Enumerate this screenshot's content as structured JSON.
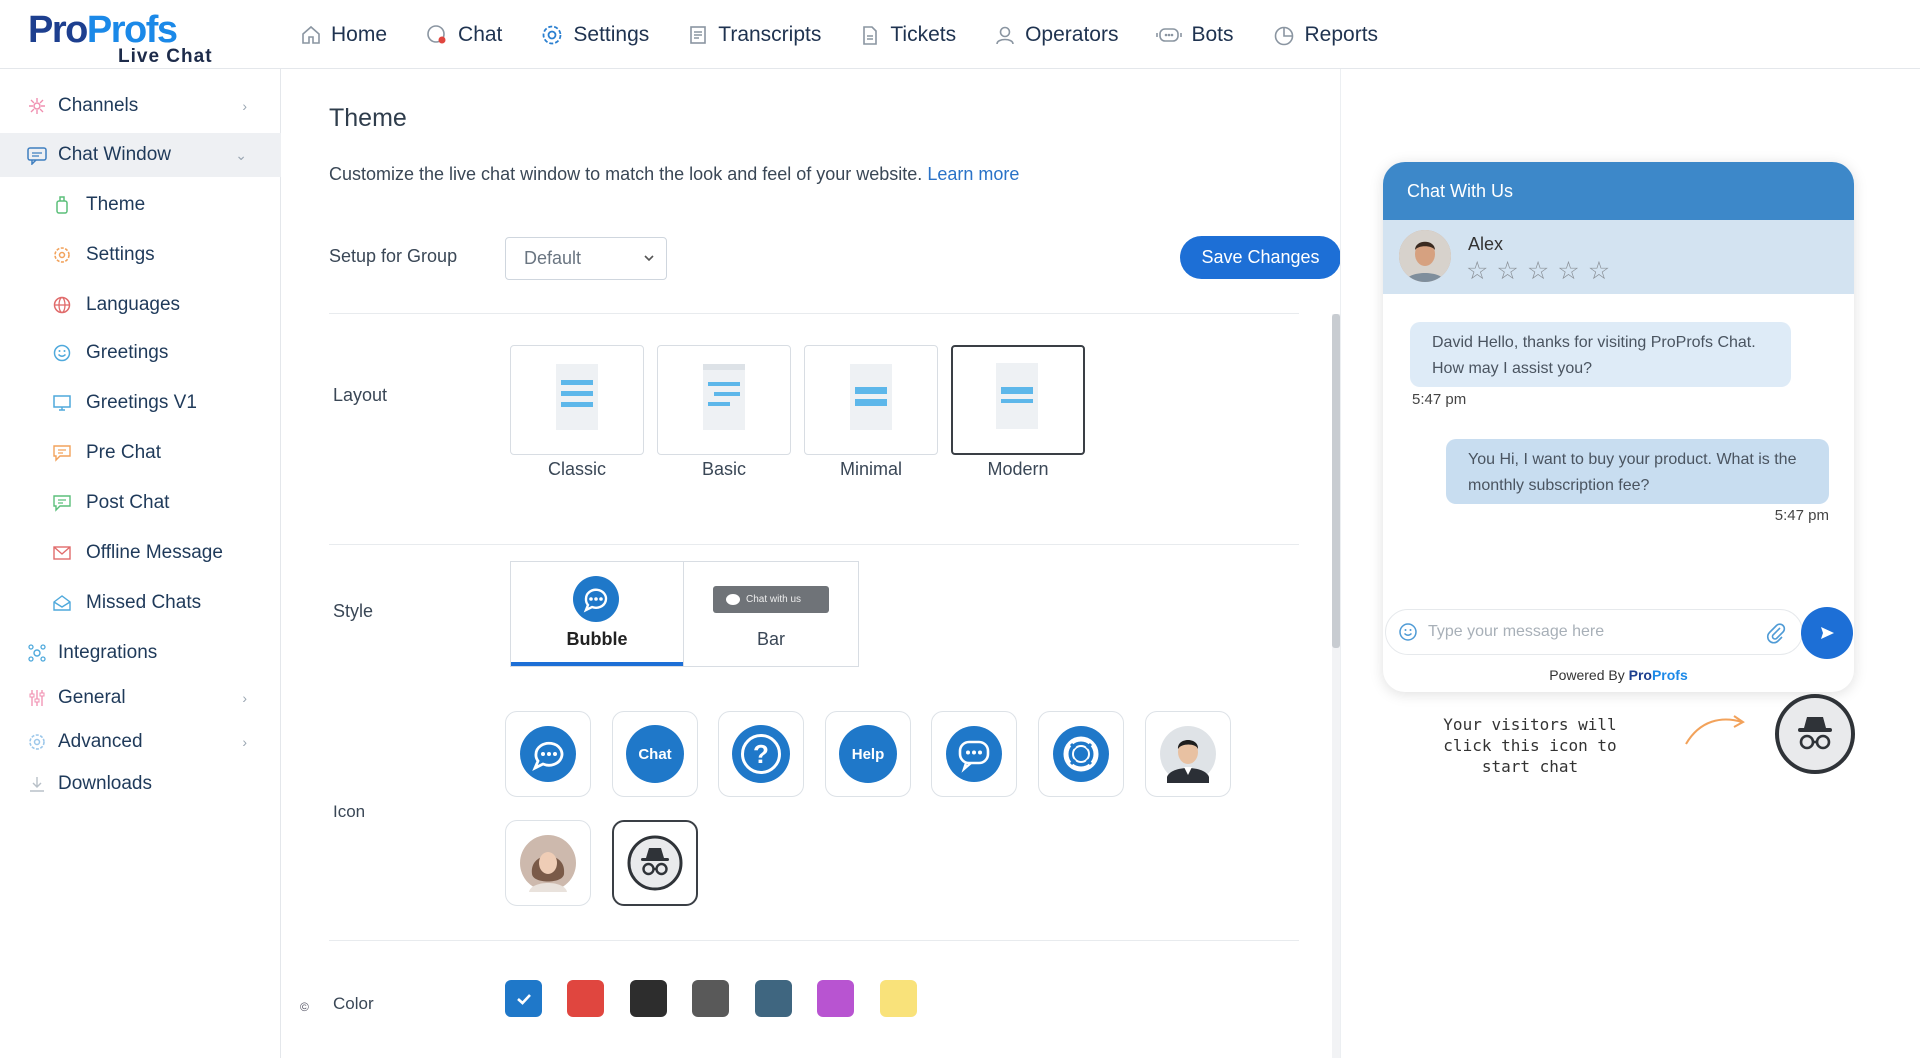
{
  "logo": {
    "main_a": "Pro",
    "main_b": "Profs",
    "sub": "Live Chat"
  },
  "nav": [
    {
      "label": "Home",
      "icon": "home-icon"
    },
    {
      "label": "Chat",
      "icon": "chat-icon"
    },
    {
      "label": "Settings",
      "icon": "settings-icon"
    },
    {
      "label": "Transcripts",
      "icon": "transcripts-icon"
    },
    {
      "label": "Tickets",
      "icon": "tickets-icon"
    },
    {
      "label": "Operators",
      "icon": "operators-icon"
    },
    {
      "label": "Bots",
      "icon": "bots-icon"
    },
    {
      "label": "Reports",
      "icon": "reports-icon"
    }
  ],
  "sidebar": {
    "items": [
      {
        "label": "Channels",
        "icon": "channels-icon"
      },
      {
        "label": "Chat Window",
        "icon": "chat-window-icon"
      },
      {
        "label": "Integrations",
        "icon": "integrations-icon"
      },
      {
        "label": "General",
        "icon": "general-icon"
      },
      {
        "label": "Advanced",
        "icon": "advanced-icon"
      },
      {
        "label": "Downloads",
        "icon": "downloads-icon"
      }
    ],
    "sub_items": [
      {
        "label": "Theme",
        "icon": "theme-icon"
      },
      {
        "label": "Settings",
        "icon": "settings-icon"
      },
      {
        "label": "Languages",
        "icon": "languages-icon"
      },
      {
        "label": "Greetings",
        "icon": "greetings-icon"
      },
      {
        "label": "Greetings V1",
        "icon": "greetings-v1-icon"
      },
      {
        "label": "Pre Chat",
        "icon": "pre-chat-icon"
      },
      {
        "label": "Post Chat",
        "icon": "post-chat-icon"
      },
      {
        "label": "Offline Message",
        "icon": "offline-message-icon"
      },
      {
        "label": "Missed Chats",
        "icon": "missed-chats-icon"
      }
    ],
    "copyright": "©"
  },
  "main": {
    "title": "Theme",
    "description": "Customize the live chat window to match the look and feel of your website.",
    "learn_more": "Learn more",
    "group_label": "Setup for Group",
    "group_value": "Default",
    "save_label": "Save Changes",
    "layout_label": "Layout",
    "layouts": [
      "Classic",
      "Basic",
      "Minimal",
      "Modern"
    ],
    "selected_layout": "Modern",
    "style_label": "Style",
    "styles": [
      "Bubble",
      "Bar"
    ],
    "bar_preview_text": "Chat with us",
    "selected_style": "Bubble",
    "icon_label": "Icon",
    "icon_texts": {
      "chat": "Chat",
      "help": "Help",
      "question": "?"
    },
    "icons": [
      "chat-bubble-icon",
      "chat-text-icon",
      "question-icon",
      "help-text-icon",
      "chat-dots-icon",
      "lifebuoy-icon",
      "male-photo-icon",
      "female-photo-icon",
      "incognito-icon"
    ],
    "selected_icon": "incognito-icon",
    "color_label": "Color",
    "colors": [
      "#1f78c9",
      "#e0463f",
      "#2d2d2d",
      "#595959",
      "#3f6680",
      "#b854d1",
      "#f9e27a"
    ],
    "selected_color": "#1f78c9"
  },
  "preview": {
    "header": "Chat With Us",
    "agent_name": "Alex",
    "rating_stars": "☆",
    "msg_in": "David Hello, thanks for visiting ProProfs Chat. How may I assist you?",
    "time_in": "5:47 pm",
    "msg_out": "You Hi, I want to buy your product. What is the monthly subscription fee?",
    "time_out": "5:47 pm",
    "input_placeholder": "Type your message here",
    "powered_by": "Powered By",
    "powered_brand_a": "Pro",
    "powered_brand_b": "Profs",
    "hint": "Your visitors will click this icon to start chat"
  }
}
